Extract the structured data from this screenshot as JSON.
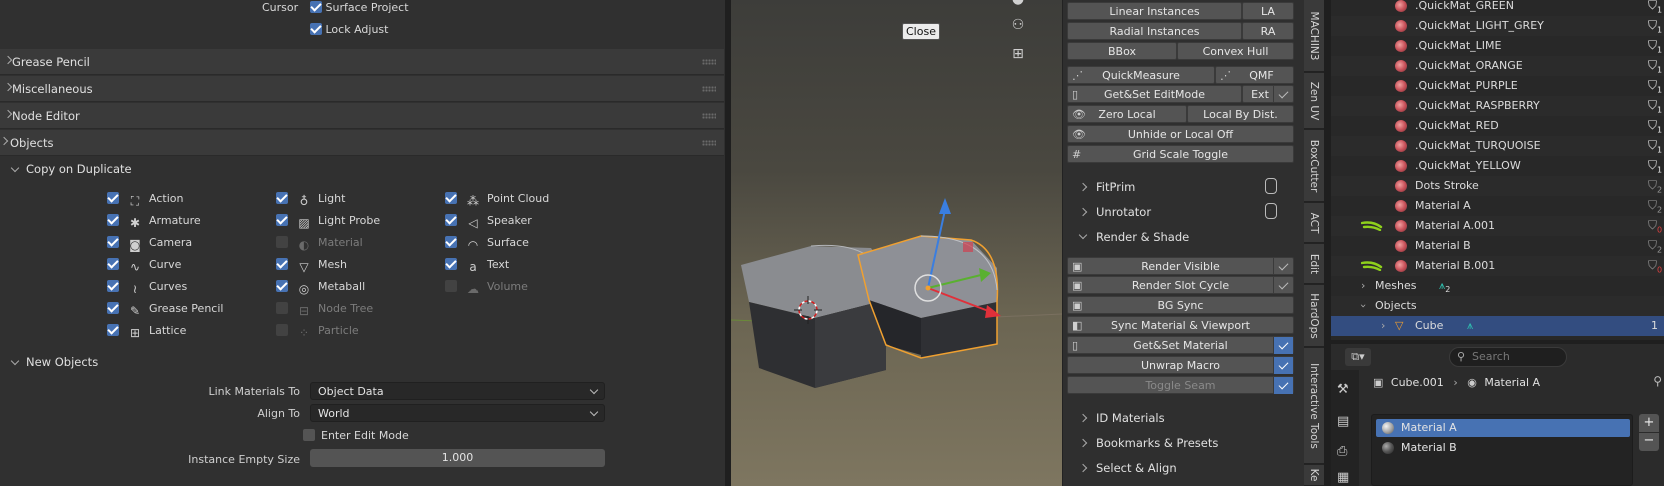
{
  "prefs": {
    "cursor_label": "Cursor",
    "surface_project": "Surface Project",
    "lock_adjust": "Lock Adjust",
    "sections": [
      "Grease Pencil",
      "Miscellaneous",
      "Node Editor",
      "Objects"
    ],
    "copy_on_duplicate": "Copy on Duplicate",
    "dup_col1": [
      {
        "label": "Action",
        "checked": true
      },
      {
        "label": "Armature",
        "checked": true
      },
      {
        "label": "Camera",
        "checked": true
      },
      {
        "label": "Curve",
        "checked": true
      },
      {
        "label": "Curves",
        "checked": true
      },
      {
        "label": "Grease Pencil",
        "checked": true
      },
      {
        "label": "Lattice",
        "checked": true
      }
    ],
    "dup_col2": [
      {
        "label": "Light",
        "checked": true
      },
      {
        "label": "Light Probe",
        "checked": true
      },
      {
        "label": "Material",
        "checked": false
      },
      {
        "label": "Mesh",
        "checked": true
      },
      {
        "label": "Metaball",
        "checked": true
      },
      {
        "label": "Node Tree",
        "checked": false
      },
      {
        "label": "Particle",
        "checked": false
      }
    ],
    "dup_col3": [
      {
        "label": "Point Cloud",
        "checked": true
      },
      {
        "label": "Speaker",
        "checked": true
      },
      {
        "label": "Surface",
        "checked": true
      },
      {
        "label": "Text",
        "checked": true
      },
      {
        "label": "Volume",
        "checked": false
      }
    ],
    "new_objects": "New Objects",
    "link_materials_label": "Link Materials To",
    "link_materials_value": "Object Data",
    "align_to_label": "Align To",
    "align_to_value": "World",
    "enter_edit_mode": "Enter Edit Mode",
    "instance_empty_label": "Instance Empty Size",
    "instance_empty_value": "1.000"
  },
  "viewport": {
    "tooltip": "Close"
  },
  "npanel": {
    "linear_instances": "Linear Instances",
    "la": "LA",
    "radial_instances": "Radial Instances",
    "ra": "RA",
    "bbox": "BBox",
    "convex_hull": "Convex Hull",
    "quickmeasure": "QuickMeasure",
    "qmf": "QMF",
    "getset_editmode": "Get&Set EditMode",
    "ext": "Ext",
    "zero_local": "Zero Local",
    "local_by_dist": "Local By Dist.",
    "unhide_local": "Unhide or Local Off",
    "grid_scale": "Grid Scale Toggle",
    "fitprim": "FitPrim",
    "unrotator": "Unrotator",
    "render_shade": "Render & Shade",
    "render_visible": "Render Visible",
    "render_slot": "Render Slot Cycle",
    "bg_sync": "BG Sync",
    "sync_material": "Sync Material & Viewport",
    "getset_material": "Get&Set Material",
    "unwrap_macro": "Unwrap Macro",
    "toggle_seam": "Toggle Seam",
    "id_materials": "ID Materials",
    "bookmarks": "Bookmarks & Presets",
    "select_align": "Select & Align"
  },
  "vtabs": [
    "MACHIN3",
    "Zen UV",
    "BoxCutter",
    "ACT",
    "Edit",
    "HardOps",
    "Interactive Tools",
    "Ke"
  ],
  "outliner": {
    "materials": [
      {
        "name": ".QuickMat_GREEN",
        "users": "1"
      },
      {
        "name": ".QuickMat_LIGHT_GREY",
        "users": "1"
      },
      {
        "name": ".QuickMat_LIME",
        "users": "1"
      },
      {
        "name": ".QuickMat_ORANGE",
        "users": "1"
      },
      {
        "name": ".QuickMat_PURPLE",
        "users": "1"
      },
      {
        "name": ".QuickMat_RASPBERRY",
        "users": "1"
      },
      {
        "name": ".QuickMat_RED",
        "users": "1"
      },
      {
        "name": ".QuickMat_TURQUOISE",
        "users": "1"
      },
      {
        "name": ".QuickMat_YELLOW",
        "users": "1"
      },
      {
        "name": "Dots Stroke",
        "users": "2"
      },
      {
        "name": "Material A",
        "users": "2"
      },
      {
        "name": "Material A.001",
        "users": "0"
      },
      {
        "name": "Material B",
        "users": "2"
      },
      {
        "name": "Material B.001",
        "users": "0"
      }
    ],
    "meshes": "Meshes",
    "meshes_count": "2",
    "objects": "Objects",
    "cube": "Cube",
    "cube_count": "1"
  },
  "properties": {
    "search_placeholder": "Search",
    "breadcrumb_object": "Cube.001",
    "breadcrumb_material": "Material A",
    "slots": [
      "Material A",
      "Material B"
    ]
  },
  "colors": {
    "accent": "#4772b3",
    "selection_outline": "#f0a030",
    "hook_green": "#8ed11c"
  }
}
